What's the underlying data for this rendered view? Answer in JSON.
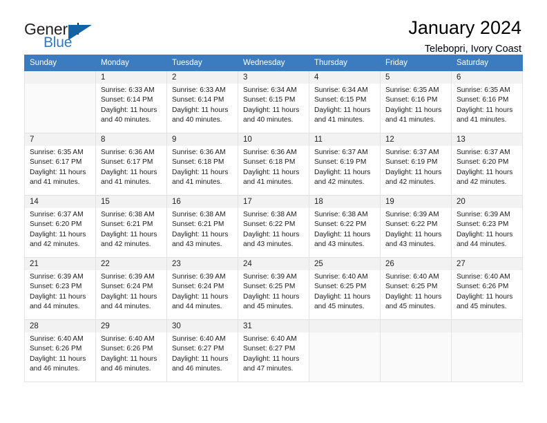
{
  "logo": {
    "word1": "General",
    "word2": "Blue",
    "triangle_color": "#1464a5",
    "blue_color": "#2f78c4"
  },
  "header": {
    "title": "January 2024",
    "subtitle": "Telebopri, Ivory Coast"
  },
  "theme": {
    "header_row_bg": "#3b7cc0",
    "header_row_text": "#ffffff",
    "daynum_bg": "#f2f2f2",
    "cell_border": "#e2e2e2"
  },
  "weekdays": [
    "Sunday",
    "Monday",
    "Tuesday",
    "Wednesday",
    "Thursday",
    "Friday",
    "Saturday"
  ],
  "labels": {
    "sunrise_prefix": "Sunrise: ",
    "sunset_prefix": "Sunset: ",
    "daylight_prefix": "Daylight: "
  },
  "weeks": [
    [
      {
        "empty": true
      },
      {
        "day": "1",
        "sunrise": "Sunrise: 6:33 AM",
        "sunset": "Sunset: 6:14 PM",
        "daylight1": "Daylight: 11 hours",
        "daylight2": "and 40 minutes."
      },
      {
        "day": "2",
        "sunrise": "Sunrise: 6:33 AM",
        "sunset": "Sunset: 6:14 PM",
        "daylight1": "Daylight: 11 hours",
        "daylight2": "and 40 minutes."
      },
      {
        "day": "3",
        "sunrise": "Sunrise: 6:34 AM",
        "sunset": "Sunset: 6:15 PM",
        "daylight1": "Daylight: 11 hours",
        "daylight2": "and 40 minutes."
      },
      {
        "day": "4",
        "sunrise": "Sunrise: 6:34 AM",
        "sunset": "Sunset: 6:15 PM",
        "daylight1": "Daylight: 11 hours",
        "daylight2": "and 41 minutes."
      },
      {
        "day": "5",
        "sunrise": "Sunrise: 6:35 AM",
        "sunset": "Sunset: 6:16 PM",
        "daylight1": "Daylight: 11 hours",
        "daylight2": "and 41 minutes."
      },
      {
        "day": "6",
        "sunrise": "Sunrise: 6:35 AM",
        "sunset": "Sunset: 6:16 PM",
        "daylight1": "Daylight: 11 hours",
        "daylight2": "and 41 minutes."
      }
    ],
    [
      {
        "day": "7",
        "sunrise": "Sunrise: 6:35 AM",
        "sunset": "Sunset: 6:17 PM",
        "daylight1": "Daylight: 11 hours",
        "daylight2": "and 41 minutes."
      },
      {
        "day": "8",
        "sunrise": "Sunrise: 6:36 AM",
        "sunset": "Sunset: 6:17 PM",
        "daylight1": "Daylight: 11 hours",
        "daylight2": "and 41 minutes."
      },
      {
        "day": "9",
        "sunrise": "Sunrise: 6:36 AM",
        "sunset": "Sunset: 6:18 PM",
        "daylight1": "Daylight: 11 hours",
        "daylight2": "and 41 minutes."
      },
      {
        "day": "10",
        "sunrise": "Sunrise: 6:36 AM",
        "sunset": "Sunset: 6:18 PM",
        "daylight1": "Daylight: 11 hours",
        "daylight2": "and 41 minutes."
      },
      {
        "day": "11",
        "sunrise": "Sunrise: 6:37 AM",
        "sunset": "Sunset: 6:19 PM",
        "daylight1": "Daylight: 11 hours",
        "daylight2": "and 42 minutes."
      },
      {
        "day": "12",
        "sunrise": "Sunrise: 6:37 AM",
        "sunset": "Sunset: 6:19 PM",
        "daylight1": "Daylight: 11 hours",
        "daylight2": "and 42 minutes."
      },
      {
        "day": "13",
        "sunrise": "Sunrise: 6:37 AM",
        "sunset": "Sunset: 6:20 PM",
        "daylight1": "Daylight: 11 hours",
        "daylight2": "and 42 minutes."
      }
    ],
    [
      {
        "day": "14",
        "sunrise": "Sunrise: 6:37 AM",
        "sunset": "Sunset: 6:20 PM",
        "daylight1": "Daylight: 11 hours",
        "daylight2": "and 42 minutes."
      },
      {
        "day": "15",
        "sunrise": "Sunrise: 6:38 AM",
        "sunset": "Sunset: 6:21 PM",
        "daylight1": "Daylight: 11 hours",
        "daylight2": "and 42 minutes."
      },
      {
        "day": "16",
        "sunrise": "Sunrise: 6:38 AM",
        "sunset": "Sunset: 6:21 PM",
        "daylight1": "Daylight: 11 hours",
        "daylight2": "and 43 minutes."
      },
      {
        "day": "17",
        "sunrise": "Sunrise: 6:38 AM",
        "sunset": "Sunset: 6:22 PM",
        "daylight1": "Daylight: 11 hours",
        "daylight2": "and 43 minutes."
      },
      {
        "day": "18",
        "sunrise": "Sunrise: 6:38 AM",
        "sunset": "Sunset: 6:22 PM",
        "daylight1": "Daylight: 11 hours",
        "daylight2": "and 43 minutes."
      },
      {
        "day": "19",
        "sunrise": "Sunrise: 6:39 AM",
        "sunset": "Sunset: 6:22 PM",
        "daylight1": "Daylight: 11 hours",
        "daylight2": "and 43 minutes."
      },
      {
        "day": "20",
        "sunrise": "Sunrise: 6:39 AM",
        "sunset": "Sunset: 6:23 PM",
        "daylight1": "Daylight: 11 hours",
        "daylight2": "and 44 minutes."
      }
    ],
    [
      {
        "day": "21",
        "sunrise": "Sunrise: 6:39 AM",
        "sunset": "Sunset: 6:23 PM",
        "daylight1": "Daylight: 11 hours",
        "daylight2": "and 44 minutes."
      },
      {
        "day": "22",
        "sunrise": "Sunrise: 6:39 AM",
        "sunset": "Sunset: 6:24 PM",
        "daylight1": "Daylight: 11 hours",
        "daylight2": "and 44 minutes."
      },
      {
        "day": "23",
        "sunrise": "Sunrise: 6:39 AM",
        "sunset": "Sunset: 6:24 PM",
        "daylight1": "Daylight: 11 hours",
        "daylight2": "and 44 minutes."
      },
      {
        "day": "24",
        "sunrise": "Sunrise: 6:39 AM",
        "sunset": "Sunset: 6:25 PM",
        "daylight1": "Daylight: 11 hours",
        "daylight2": "and 45 minutes."
      },
      {
        "day": "25",
        "sunrise": "Sunrise: 6:40 AM",
        "sunset": "Sunset: 6:25 PM",
        "daylight1": "Daylight: 11 hours",
        "daylight2": "and 45 minutes."
      },
      {
        "day": "26",
        "sunrise": "Sunrise: 6:40 AM",
        "sunset": "Sunset: 6:25 PM",
        "daylight1": "Daylight: 11 hours",
        "daylight2": "and 45 minutes."
      },
      {
        "day": "27",
        "sunrise": "Sunrise: 6:40 AM",
        "sunset": "Sunset: 6:26 PM",
        "daylight1": "Daylight: 11 hours",
        "daylight2": "and 45 minutes."
      }
    ],
    [
      {
        "day": "28",
        "sunrise": "Sunrise: 6:40 AM",
        "sunset": "Sunset: 6:26 PM",
        "daylight1": "Daylight: 11 hours",
        "daylight2": "and 46 minutes."
      },
      {
        "day": "29",
        "sunrise": "Sunrise: 6:40 AM",
        "sunset": "Sunset: 6:26 PM",
        "daylight1": "Daylight: 11 hours",
        "daylight2": "and 46 minutes."
      },
      {
        "day": "30",
        "sunrise": "Sunrise: 6:40 AM",
        "sunset": "Sunset: 6:27 PM",
        "daylight1": "Daylight: 11 hours",
        "daylight2": "and 46 minutes."
      },
      {
        "day": "31",
        "sunrise": "Sunrise: 6:40 AM",
        "sunset": "Sunset: 6:27 PM",
        "daylight1": "Daylight: 11 hours",
        "daylight2": "and 47 minutes."
      },
      {
        "empty": true
      },
      {
        "empty": true
      },
      {
        "empty": true
      }
    ]
  ]
}
